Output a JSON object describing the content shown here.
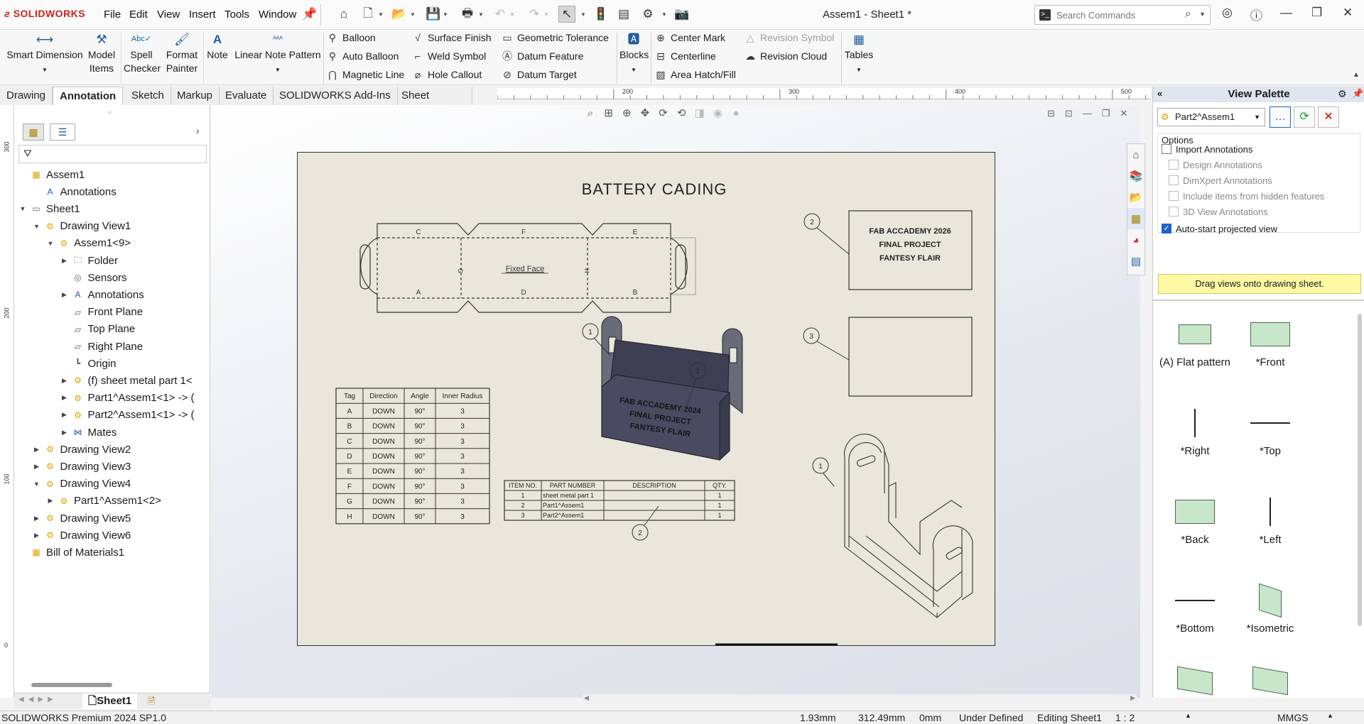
{
  "app": {
    "name": "SOLIDWORKS",
    "doc_title": "Assem1 - Sheet1 *",
    "search_placeholder": "Search Commands"
  },
  "menu": [
    "File",
    "Edit",
    "View",
    "Insert",
    "Tools",
    "Window"
  ],
  "ribbon": {
    "smart_dimension": "Smart Dimension",
    "model_items": [
      "Model",
      "Items"
    ],
    "spell_checker": [
      "Spell",
      "Checker"
    ],
    "format_painter": [
      "Format",
      "Painter"
    ],
    "note": "Note",
    "linear_note_pattern": "Linear Note Pattern",
    "balloon": "Balloon",
    "auto_balloon": "Auto Balloon",
    "magnetic_line": "Magnetic Line",
    "surface_finish": "Surface Finish",
    "weld_symbol": "Weld Symbol",
    "hole_callout": "Hole Callout",
    "geometric_tolerance": "Geometric Tolerance",
    "datum_feature": "Datum Feature",
    "datum_target": "Datum Target",
    "blocks": "Blocks",
    "center_mark": "Center Mark",
    "centerline": "Centerline",
    "area_hatch": "Area Hatch/Fill",
    "revision_symbol": "Revision Symbol",
    "revision_cloud": "Revision Cloud",
    "tables": "Tables"
  },
  "tabs": [
    "Drawing",
    "Annotation",
    "Sketch",
    "Markup",
    "Evaluate",
    "SOLIDWORKS Add-Ins",
    "Sheet Format"
  ],
  "active_tab": "Annotation",
  "ruler": {
    "top": [
      "200",
      "300",
      "400",
      "500"
    ],
    "left": [
      "300",
      "200",
      "100",
      "0"
    ]
  },
  "tree": [
    {
      "label": "Assem1",
      "icon": "assembly-drawing-icon",
      "indent": 0,
      "exp": ""
    },
    {
      "label": "Annotations",
      "icon": "annotations-icon",
      "indent": 1,
      "exp": ""
    },
    {
      "label": "Sheet1",
      "icon": "sheet-icon",
      "indent": 0,
      "exp": "▼"
    },
    {
      "label": "Drawing View1",
      "icon": "drawing-view-icon",
      "indent": 1,
      "exp": "▼"
    },
    {
      "label": "Assem1<9>",
      "icon": "assembly-icon",
      "indent": 2,
      "exp": "▼"
    },
    {
      "label": "Folder",
      "icon": "folder-icon",
      "indent": 3,
      "exp": "▶"
    },
    {
      "label": "Sensors",
      "icon": "sensors-icon",
      "indent": 3,
      "exp": ""
    },
    {
      "label": "Annotations",
      "icon": "annotations-icon",
      "indent": 3,
      "exp": "▶"
    },
    {
      "label": "Front Plane",
      "icon": "plane-icon",
      "indent": 3,
      "exp": ""
    },
    {
      "label": "Top Plane",
      "icon": "plane-icon",
      "indent": 3,
      "exp": ""
    },
    {
      "label": "Right Plane",
      "icon": "plane-icon",
      "indent": 3,
      "exp": ""
    },
    {
      "label": "Origin",
      "icon": "origin-icon",
      "indent": 3,
      "exp": ""
    },
    {
      "label": "(f) sheet metal part 1<",
      "icon": "part-icon",
      "indent": 3,
      "exp": "▶"
    },
    {
      "label": "Part1^Assem1<1> -> (",
      "icon": "part-icon",
      "indent": 3,
      "exp": "▶"
    },
    {
      "label": "Part2^Assem1<1> -> (",
      "icon": "part-icon",
      "indent": 3,
      "exp": "▶"
    },
    {
      "label": "Mates",
      "icon": "mates-icon",
      "indent": 3,
      "exp": "▶"
    },
    {
      "label": "Drawing View2",
      "icon": "drawing-view-icon",
      "indent": 1,
      "exp": "▶"
    },
    {
      "label": "Drawing View3",
      "icon": "drawing-view-icon",
      "indent": 1,
      "exp": "▶"
    },
    {
      "label": "Drawing View4",
      "icon": "drawing-view-icon",
      "indent": 1,
      "exp": "▼"
    },
    {
      "label": "Part1^Assem1<2>",
      "icon": "part-icon",
      "indent": 2,
      "exp": "▶"
    },
    {
      "label": "Drawing View5",
      "icon": "drawing-view-icon",
      "indent": 1,
      "exp": "▶"
    },
    {
      "label": "Drawing View6",
      "icon": "drawing-view-icon",
      "indent": 1,
      "exp": "▶"
    },
    {
      "label": "Bill of Materials1",
      "icon": "bom-icon",
      "indent": 0,
      "exp": ""
    }
  ],
  "sheet_tab": "Sheet1",
  "drawing": {
    "title": "BATTERY CADING",
    "fixed_face": "Fixed Face",
    "flat_labels_top": [
      "C",
      "F",
      "E"
    ],
    "flat_labels_bottom": [
      "A",
      "D",
      "B"
    ],
    "flat_labels_side": [
      "G",
      "H"
    ],
    "box_text": [
      "FAB ACCADEMY 2026",
      "FINAL PROJECT",
      "FANTESY FLAIR"
    ],
    "iso_text": [
      "FAB ACCADEMY 2024",
      "FINAL PROJECT",
      "FANTESY FLAIR"
    ],
    "balloons": [
      "1",
      "2",
      "3"
    ],
    "bend_table": {
      "headers": [
        "Tag",
        "Direction",
        "Angle",
        "Inner Radius"
      ],
      "rows": [
        [
          "A",
          "DOWN",
          "90°",
          "3"
        ],
        [
          "B",
          "DOWN",
          "90°",
          "3"
        ],
        [
          "C",
          "DOWN",
          "90°",
          "3"
        ],
        [
          "D",
          "DOWN",
          "90°",
          "3"
        ],
        [
          "E",
          "DOWN",
          "90°",
          "3"
        ],
        [
          "F",
          "DOWN",
          "90°",
          "3"
        ],
        [
          "G",
          "DOWN",
          "90°",
          "3"
        ],
        [
          "H",
          "DOWN",
          "90°",
          "3"
        ]
      ]
    },
    "bom": {
      "headers": [
        "ITEM NO.",
        "PART NUMBER",
        "DESCRIPTION",
        "QTY."
      ],
      "rows": [
        [
          "1",
          "sheet metal part 1",
          "",
          "1"
        ],
        [
          "2",
          "Part1^Assem1",
          "",
          "1"
        ],
        [
          "3",
          "Part2^Assem1",
          "",
          "1"
        ]
      ]
    }
  },
  "view_palette": {
    "title": "View Palette",
    "selected": "Part2^Assem1",
    "options_label": "Options",
    "options": [
      {
        "label": "Import Annotations",
        "checked": false,
        "enabled": true
      },
      {
        "label": "Design Annotations",
        "checked": false,
        "enabled": false
      },
      {
        "label": "DimXpert Annotations",
        "checked": false,
        "enabled": false
      },
      {
        "label": "Include items from hidden features",
        "checked": false,
        "enabled": false
      },
      {
        "label": "3D View Annotations",
        "checked": false,
        "enabled": false
      },
      {
        "label": "Auto-start projected view",
        "checked": true,
        "enabled": true
      }
    ],
    "drag_hint": "Drag views onto drawing sheet.",
    "views": [
      "(A) Flat pattern",
      "*Front",
      "*Right",
      "*Top",
      "*Back",
      "*Left",
      "*Bottom",
      "*Isometric"
    ]
  },
  "status": {
    "product": "SOLIDWORKS Premium 2024 SP1.0",
    "x": "1.93mm",
    "y": "312.49mm",
    "z": "0mm",
    "state": "Under Defined",
    "editing": "Editing Sheet1",
    "scale": "1 : 2",
    "units": "MMGS"
  }
}
